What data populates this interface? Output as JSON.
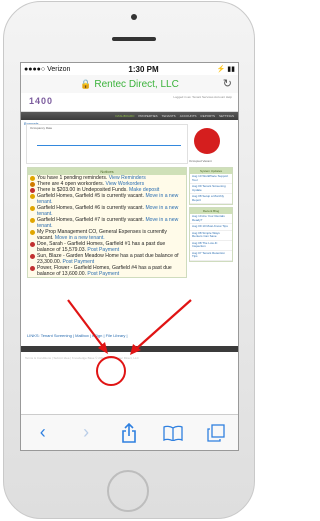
{
  "status": {
    "carrier": "●●●●○ Verizon",
    "time": "1:30 PM",
    "right_icons": "⚡ ▮▮"
  },
  "address_bar": {
    "host": "Rentec Direct, LLC",
    "lock_icon": "lock-icon",
    "reload_icon": "reload-icon"
  },
  "site": {
    "logo": "1400",
    "top_links": "Logged in as: Tenant Services   Account Help",
    "nav": [
      "DASHBOARD",
      "PROPERTIES",
      "TENANTS",
      "ACCOUNTS",
      "REPORTS",
      "SETTINGS"
    ],
    "breadcrumb": "Bonnets",
    "chart_title": "Occupancy Rate",
    "legend": "Occupied Vacant",
    "notices_header": "Notices",
    "notices": [
      {
        "text": "You have 1 pending reminders.",
        "link": "View Reminders",
        "color": "#e0a600"
      },
      {
        "text": "There are 4 open workorders.",
        "link": "View Workorders",
        "color": "#d07a00"
      },
      {
        "text": "There is $203.00 in Undeposited Funds.",
        "link": "Make deposit",
        "color": "#c23030"
      },
      {
        "text": "Garfield Homes, Garfield #5 is currently vacant.",
        "link": "Move in a new tenant.",
        "color": "#e0a600"
      },
      {
        "text": "Garfield Homes, Garfield #6 is currently vacant.",
        "link": "Move in a new tenant.",
        "color": "#e0a600"
      },
      {
        "text": "Garfield Homes, Garfield #7 is currently vacant.",
        "link": "Move in a new tenant.",
        "color": "#e0a600"
      },
      {
        "text": "My Prop Management CO, General Expenses is currently vacant.",
        "link": "Move in a new tenant.",
        "color": "#e0a600"
      },
      {
        "text": "Doe, Sarah - Garfield Homes, Garfield #1 has a past due balance of 15,579.03.",
        "link": "Post Payment",
        "color": "#c23030"
      },
      {
        "text": "Sun, Blaze - Garden Meadow Home has a past due balance of 23,300.00.",
        "link": "Post Payment",
        "color": "#c23030"
      },
      {
        "text": "Power, Flower - Garfield Homes, Garfield #4 has a past due balance of 13,600.00.",
        "link": "Post Payment",
        "color": "#c23030"
      }
    ],
    "side_updates_header": "System Updates",
    "side_updates": [
      "Aug 10  WorkPlace Support Tool",
      "Aug 09  Tenant Screening Update",
      "Aug 08  Setup a Monthly Report"
    ],
    "side_blog_header": "Recent Blog",
    "side_blog": [
      "Aug 10  Are Your Rentals Ready?",
      "Aug 09  10 Must-Know Tips",
      "Aug 08  Simple Ways Renters Can Save",
      "Aug 08  The Low-Fi Inspection",
      "Aug 07  Tenant Retention Tips"
    ],
    "links_row": "LINKS: Tenant Screening | Mailbox | eSign | File Library |",
    "footer": "Terms & Conditions  |  Submit Idea  |  Knowledge Base       © 2001-2016 Rentec Direct, LLC"
  },
  "toolbar": {
    "back_icon": "back-chevron-icon",
    "forward_icon": "forward-chevron-icon",
    "share_icon": "share-icon",
    "bookmarks_icon": "bookmarks-icon",
    "tabs_icon": "tabs-icon"
  }
}
